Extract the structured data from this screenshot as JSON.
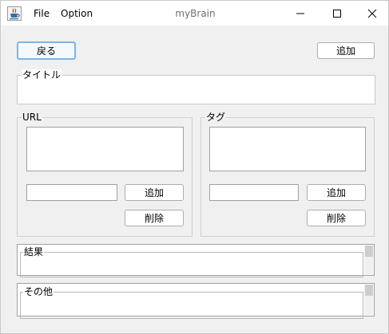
{
  "window": {
    "title": "myBrain",
    "icon": "java-cup-icon"
  },
  "menu": {
    "file": "File",
    "option": "Option"
  },
  "toolbar": {
    "back_label": "戻る",
    "add_label": "追加"
  },
  "title_field": {
    "legend": "タイトル",
    "value": ""
  },
  "url_panel": {
    "legend": "URL",
    "input_value": "",
    "add_label": "追加",
    "delete_label": "削除"
  },
  "tag_panel": {
    "legend": "タグ",
    "input_value": "",
    "add_label": "追加",
    "delete_label": "削除"
  },
  "result_panel": {
    "legend": "結果"
  },
  "other_panel": {
    "legend": "その他"
  },
  "colors": {
    "client_bg": "#f0f0f0",
    "focus_border": "#7eb4ea"
  }
}
